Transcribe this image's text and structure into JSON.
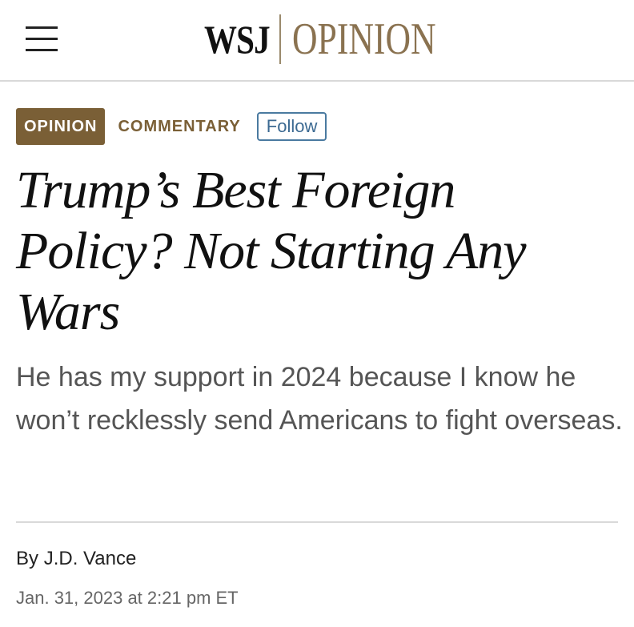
{
  "header": {
    "brand_wsj": "WSJ",
    "brand_section": "OPINION",
    "menu_icon": "hamburger-menu-icon"
  },
  "article": {
    "section_badge": "OPINION",
    "category": "COMMENTARY",
    "follow_label": "Follow",
    "headline": "Trump’s Best Foreign Policy? Not Starting Any Wars",
    "dek": "He has my support in 2024 because I know he won’t recklessly send Americans to fight overseas.",
    "byline_prefix": "By ",
    "author": "J.D. Vance",
    "timestamp": "Jan. 31, 2023 at 2:21 pm ET"
  },
  "colors": {
    "opinion_brown": "#7a5f36",
    "brand_opinion": "#8a7250",
    "follow_blue": "#3c6a92",
    "dek_gray": "#555555"
  }
}
